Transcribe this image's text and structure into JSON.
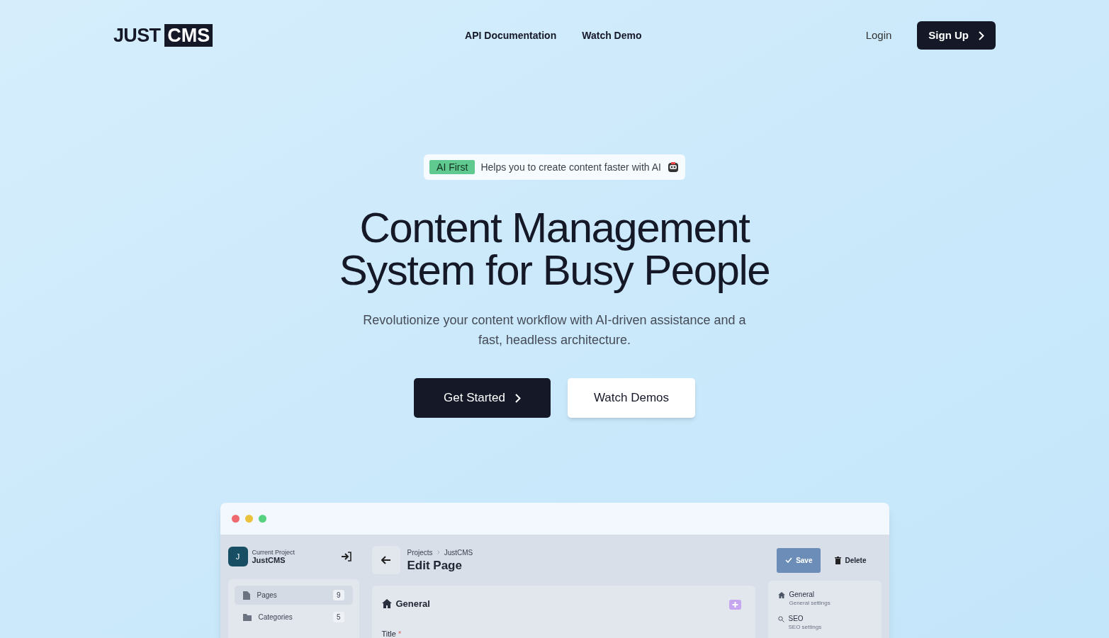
{
  "header": {
    "logo": {
      "plain": "JUST",
      "boxed": "CMS"
    },
    "links": [
      "API Documentation",
      "Watch Demo"
    ],
    "login": "Login",
    "signup": "Sign Up"
  },
  "hero": {
    "badge": {
      "tag": "AI First",
      "text": "Helps you to create content faster with AI"
    },
    "title": [
      "Content Management",
      "System for Busy People"
    ],
    "subtitle": [
      "Revolutionize your content workflow with AI-driven assistance and a",
      "fast, headless architecture."
    ],
    "primary_button": "Get Started",
    "secondary_button": "Watch Demos"
  },
  "app_preview": {
    "project": {
      "avatar": "J",
      "label": "Current Project",
      "name": "JustCMS"
    },
    "nav_items": [
      {
        "label": "Pages",
        "count": "9",
        "selected": true,
        "kind": "file"
      },
      {
        "label": "Categories",
        "count": "5",
        "selected": false,
        "kind": "folder"
      }
    ],
    "breadcrumb": [
      "Projects",
      "JustCMS"
    ],
    "page_title": "Edit Page",
    "save": "Save",
    "delete": "Delete",
    "section_title": "General",
    "field_label": "Title",
    "required_mark": "*",
    "outline": [
      {
        "title": "General",
        "subtitle": "General settings",
        "kind": "home"
      },
      {
        "title": "SEO",
        "subtitle": "SEO settings",
        "kind": "search"
      }
    ]
  }
}
